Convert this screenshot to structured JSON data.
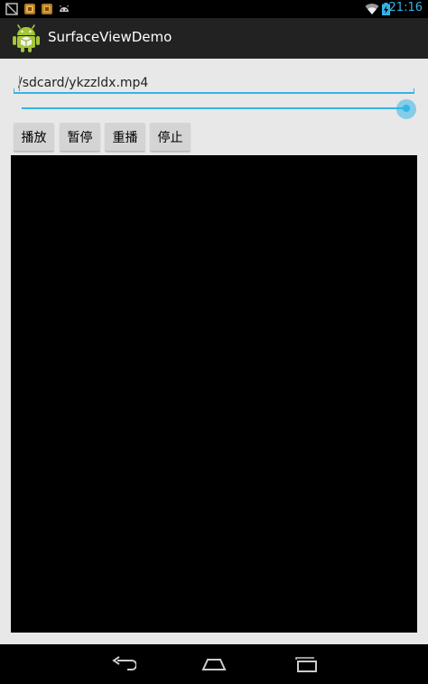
{
  "status_bar": {
    "time": "21:16",
    "left_icons": [
      "notification-screenshot-icon",
      "notification-app-icon",
      "notification-app-icon",
      "notification-android-debug-icon"
    ],
    "right_icons": [
      "wifi-icon",
      "battery-charging-icon"
    ],
    "accent_color": "#33b5e5"
  },
  "action_bar": {
    "title": "SurfaceViewDemo",
    "icon": "android-app-icon"
  },
  "file_path": {
    "value": "/sdcard/ykzzldx.mp4"
  },
  "seekbar": {
    "progress": 1.0
  },
  "controls": {
    "play_label": "播放",
    "pause_label": "暂停",
    "replay_label": "重播",
    "stop_label": "停止"
  },
  "navigation_bar": {
    "icons": [
      "back-icon",
      "home-icon",
      "recent-apps-icon"
    ]
  }
}
